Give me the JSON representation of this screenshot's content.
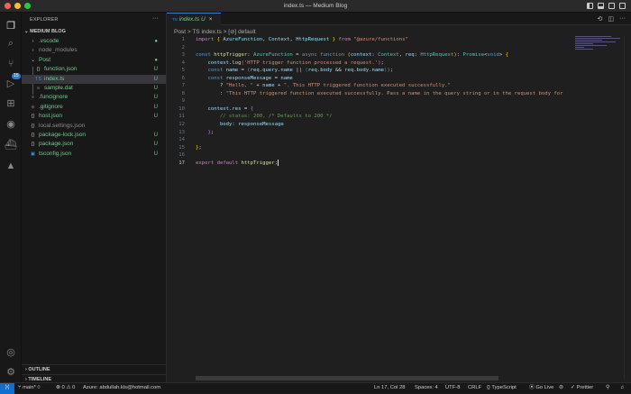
{
  "window": {
    "title": "index.ts — Medium Blog"
  },
  "activity": {
    "source_control_badge": "15"
  },
  "explorer": {
    "header": "EXPLORER",
    "more": "···",
    "project": "MEDIUM BLOG",
    "items": [
      {
        "label": ".vscode",
        "kind": "folder-closed",
        "icon": "›",
        "badge": "●",
        "color": "#73c991"
      },
      {
        "label": "node_modules",
        "kind": "folder-closed",
        "icon": "›",
        "badge": "",
        "color": "#8b8b8b"
      },
      {
        "label": "Post",
        "kind": "folder-open",
        "icon": "⌄",
        "badge": "●",
        "color": "#73c991"
      },
      {
        "label": "function.json",
        "kind": "json",
        "icon": "{}",
        "badge": "U",
        "color": "#73c991"
      },
      {
        "label": "index.ts",
        "kind": "ts",
        "icon": "TS",
        "badge": "U",
        "color": "#73c991"
      },
      {
        "label": "sample.dat",
        "kind": "file",
        "icon": "≡",
        "badge": "U",
        "color": "#73c991"
      },
      {
        "label": ".funcignore",
        "kind": "file",
        "icon": "≡",
        "badge": "U",
        "color": "#73c991"
      },
      {
        "label": ".gitignore",
        "kind": "git",
        "icon": "◆",
        "badge": "U",
        "color": "#73c991"
      },
      {
        "label": "host.json",
        "kind": "json",
        "icon": "{}",
        "badge": "U",
        "color": "#73c991"
      },
      {
        "label": "local.settings.json",
        "kind": "json",
        "icon": "{}",
        "badge": "",
        "color": "#8b8b8b"
      },
      {
        "label": "package-lock.json",
        "kind": "json",
        "icon": "{}",
        "badge": "U",
        "color": "#73c991"
      },
      {
        "label": "package.json",
        "kind": "json",
        "icon": "{}",
        "badge": "U",
        "color": "#73c991"
      },
      {
        "label": "tsconfig.json",
        "kind": "tsconfig",
        "icon": "▣",
        "badge": "U",
        "color": "#73c991"
      }
    ],
    "outline": "OUTLINE",
    "timeline": "TIMELINE"
  },
  "tab": {
    "icon": "TS",
    "label": "index.ts",
    "status": "U",
    "close": "×"
  },
  "breadcrumb": [
    "Post",
    ">",
    "TS index.ts",
    ">",
    "[⊘] default"
  ],
  "code": {
    "current_line": 17,
    "lines": [
      [
        [
          "import ",
          "ctl"
        ],
        [
          "{ ",
          "br"
        ],
        [
          "AzureFunction",
          "var"
        ],
        [
          ", ",
          "pn"
        ],
        [
          "Context",
          "var"
        ],
        [
          ", ",
          "pn"
        ],
        [
          "HttpRequest",
          "var"
        ],
        [
          " }",
          "br"
        ],
        [
          " from ",
          "ctl"
        ],
        [
          "\"@azure/functions\"",
          "str"
        ]
      ],
      [],
      [
        [
          "const ",
          "kw"
        ],
        [
          "httpTrigger",
          "fn"
        ],
        [
          ": ",
          "pn"
        ],
        [
          "AzureFunction",
          "ty"
        ],
        [
          " = ",
          "pn"
        ],
        [
          "async ",
          "kw"
        ],
        [
          "function ",
          "kw"
        ],
        [
          "(",
          "br"
        ],
        [
          "context",
          "var"
        ],
        [
          ": ",
          "pn"
        ],
        [
          "Context",
          "ty"
        ],
        [
          ", ",
          "pn"
        ],
        [
          "req",
          "var"
        ],
        [
          ": ",
          "pn"
        ],
        [
          "HttpRequest",
          "ty"
        ],
        [
          ")",
          "br"
        ],
        [
          ": ",
          "pn"
        ],
        [
          "Promise",
          "ty"
        ],
        [
          "<",
          "pn"
        ],
        [
          "void",
          "kw"
        ],
        [
          ">",
          "pn"
        ],
        [
          " {",
          "br"
        ]
      ],
      [
        [
          "    context",
          "var"
        ],
        [
          ".",
          "pn"
        ],
        [
          "log",
          "fn"
        ],
        [
          "(",
          "br2"
        ],
        [
          "'HTTP trigger function processed a request.'",
          "str"
        ],
        [
          ")",
          "br2"
        ],
        [
          ";",
          "pn"
        ]
      ],
      [
        [
          "    const ",
          "kw"
        ],
        [
          "name",
          "var"
        ],
        [
          " = ",
          "pn"
        ],
        [
          "(",
          "br2"
        ],
        [
          "req",
          "var"
        ],
        [
          ".",
          "pn"
        ],
        [
          "query",
          "var"
        ],
        [
          ".",
          "pn"
        ],
        [
          "name",
          "var"
        ],
        [
          " || ",
          "pn"
        ],
        [
          "(",
          "br3"
        ],
        [
          "req",
          "var"
        ],
        [
          ".",
          "pn"
        ],
        [
          "body",
          "var"
        ],
        [
          " && ",
          "pn"
        ],
        [
          "req",
          "var"
        ],
        [
          ".",
          "pn"
        ],
        [
          "body",
          "var"
        ],
        [
          ".",
          "pn"
        ],
        [
          "name",
          "var"
        ],
        [
          ")",
          "br3"
        ],
        [
          ")",
          "br2"
        ],
        [
          ";",
          "pn"
        ]
      ],
      [
        [
          "    const ",
          "kw"
        ],
        [
          "responseMessage",
          "var"
        ],
        [
          " = ",
          "pn"
        ],
        [
          "name",
          "var"
        ]
      ],
      [
        [
          "        ? ",
          "pn"
        ],
        [
          "\"Hello, \"",
          "str"
        ],
        [
          " + ",
          "pn"
        ],
        [
          "name",
          "var"
        ],
        [
          " + ",
          "pn"
        ],
        [
          "\". This HTTP triggered function executed successfully.\"",
          "str"
        ]
      ],
      [
        [
          "        : ",
          "pn"
        ],
        [
          "\"This HTTP triggered function executed successfully. Pass a name in the query string or in the request body for",
          "str"
        ]
      ],
      [],
      [
        [
          "    context",
          "var"
        ],
        [
          ".",
          "pn"
        ],
        [
          "res",
          "var"
        ],
        [
          " = ",
          "pn"
        ],
        [
          "{",
          "br2"
        ]
      ],
      [
        [
          "        // status: 200, /* Defaults to 200 */",
          "cm"
        ]
      ],
      [
        [
          "        body",
          "var"
        ],
        [
          ": ",
          "pn"
        ],
        [
          "responseMessage",
          "var"
        ]
      ],
      [
        [
          "    }",
          "br2"
        ],
        [
          ";",
          "pn"
        ]
      ],
      [],
      [
        [
          "}",
          "br"
        ],
        [
          ";",
          "pn"
        ]
      ],
      [],
      [
        [
          "export ",
          "ctl"
        ],
        [
          "default ",
          "ctl"
        ],
        [
          "httpTrigger",
          "fn"
        ],
        [
          ";",
          "pn"
        ]
      ]
    ]
  },
  "status": {
    "remote": "⟩⟨",
    "branch": "main*",
    "sync": "⟳",
    "errors": "0",
    "warnings": "0",
    "azure": "Azure: abdullah.kls@hotmail.com",
    "position": "Ln 17, Col 28",
    "spaces": "Spaces: 4",
    "encoding": "UTF-8",
    "eol": "CRLF",
    "language": "TypeScript",
    "golive": "Go Live",
    "prettier": "Prettier"
  }
}
